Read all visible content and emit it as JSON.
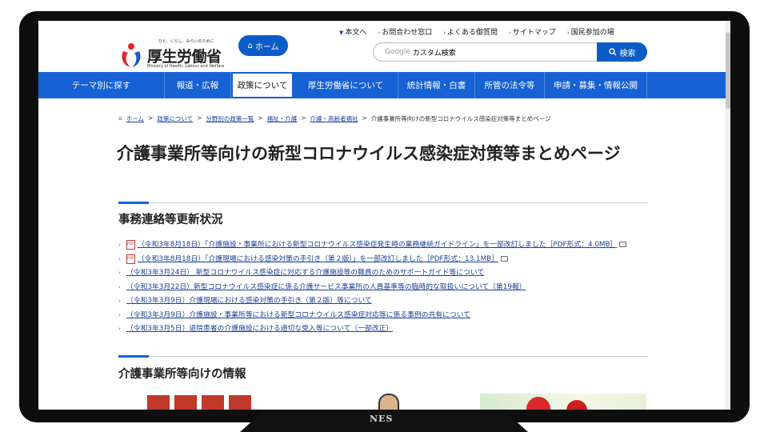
{
  "logo": {
    "tagline": "ひと、くらし、みらいのために",
    "name": "厚生労働省",
    "english": "Ministry of Health, Labour and Welfare"
  },
  "home_button": "ホーム",
  "top_links": [
    "本文へ",
    "お問合わせ窓口",
    "よくある御質問",
    "サイトマップ",
    "国民参加の場"
  ],
  "search": {
    "brand": "Google",
    "placeholder": "カスタム検索",
    "button": "検索"
  },
  "nav": [
    {
      "label": "テーマ別に探す",
      "active": false
    },
    {
      "label": "報道・広報",
      "active": false
    },
    {
      "label": "政策について",
      "active": true
    },
    {
      "label": "厚生労働省について",
      "active": false
    },
    {
      "label": "統計情報・白書",
      "active": false
    },
    {
      "label": "所管の法令等",
      "active": false
    },
    {
      "label": "申請・募集・情報公開",
      "active": false
    }
  ],
  "breadcrumb": [
    "ホーム",
    "政策について",
    "分野別の政策一覧",
    "福祉・介護",
    "介護・高齢者福祉",
    "介護事業所等向けの新型コロナウイルス感染症対策等まとめページ"
  ],
  "page_title": "介護事業所等向けの新型コロナウイルス感染症対策等まとめページ",
  "section1": {
    "heading": "事務連絡等更新状況",
    "items": [
      {
        "text": "（令和3年8月18日）「介護施設・事業所における新型コロナウイルス感染症発生時の業務継続ガイドライン」を一部改訂しました［PDF形式：4.0MB］",
        "pdf": true,
        "external": true
      },
      {
        "text": "（令和3年8月18日）「介護現場における感染対策の手引き（第２版）」を一部改訂しました［PDF形式：13.1MB］",
        "pdf": true,
        "external": true
      },
      {
        "text": "（令和3年3月24日） 新型コロナウイルス感染症に対応する介護施設等の職員のためのサポートガイド等について",
        "pdf": false,
        "external": false
      },
      {
        "text": "（令和3年3月22日）新型コロナウイルス感染症に係る介護サービス事業所の人員基準等の臨時的な取扱いについて（第19報）",
        "pdf": false,
        "external": false
      },
      {
        "text": "（令和3年3月9日）介護現場における感染対策の手引き（第２版）等について",
        "pdf": false,
        "external": false
      },
      {
        "text": "（令和3年3月9日）介護施設・事業所等における新型コロナウイルス感染症対応等に係る事例の共有について",
        "pdf": false,
        "external": false
      },
      {
        "text": "（令和3年3月5日）退院患者の介護施設における適切な受入等について（一部改正）",
        "pdf": false,
        "external": false
      }
    ]
  },
  "section2": {
    "heading": "介護事業所等向けの情報"
  },
  "watermark": "NES",
  "colors": {
    "brand_blue": "#1661d4",
    "link": "#1a3f9c"
  }
}
